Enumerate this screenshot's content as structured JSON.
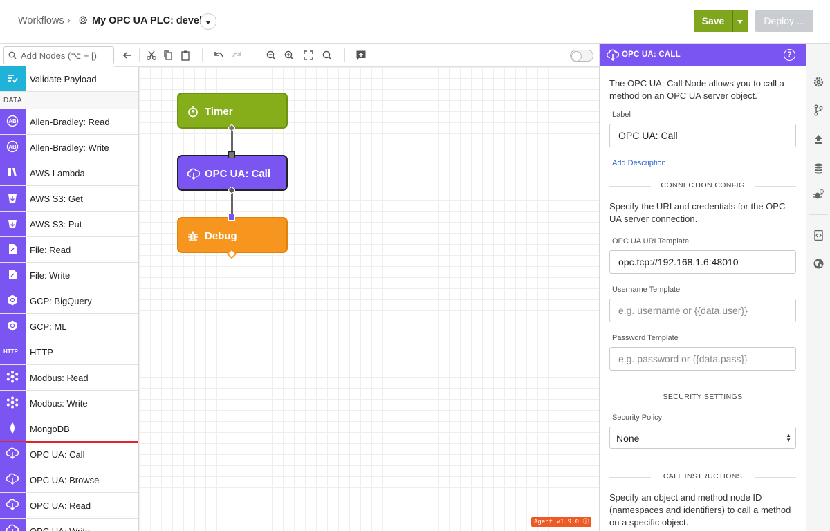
{
  "header": {
    "breadcrumb": "Workflows",
    "separator": "›",
    "workflow_title": "My OPC UA PLC: develop",
    "save_label": "Save",
    "deploy_label": "Deploy ..."
  },
  "palette": {
    "search_placeholder": "Add Nodes (⌥ + [)",
    "top_item": {
      "label": "Validate Payload",
      "icon": "validate-icon"
    },
    "section_label": "DATA",
    "items": [
      {
        "label": "Allen-Bradley: Read",
        "icon": "ab-icon"
      },
      {
        "label": "Allen-Bradley: Write",
        "icon": "ab-icon"
      },
      {
        "label": "AWS Lambda",
        "icon": "lambda-icon"
      },
      {
        "label": "AWS S3: Get",
        "icon": "bucket-icon"
      },
      {
        "label": "AWS S3: Put",
        "icon": "bucket-icon"
      },
      {
        "label": "File: Read",
        "icon": "file-icon"
      },
      {
        "label": "File: Write",
        "icon": "file-icon"
      },
      {
        "label": "GCP: BigQuery",
        "icon": "gcp-icon"
      },
      {
        "label": "GCP: ML",
        "icon": "gcp-icon"
      },
      {
        "label": "HTTP",
        "icon": "http-icon"
      },
      {
        "label": "Modbus: Read",
        "icon": "modbus-icon"
      },
      {
        "label": "Modbus: Write",
        "icon": "modbus-icon"
      },
      {
        "label": "MongoDB",
        "icon": "mongodb-icon"
      },
      {
        "label": "OPC UA: Call",
        "icon": "cloud-icon"
      },
      {
        "label": "OPC UA: Browse",
        "icon": "cloud-icon"
      },
      {
        "label": "OPC UA: Read",
        "icon": "cloud-icon"
      },
      {
        "label": "OPC UA: Write",
        "icon": "cloud-icon"
      }
    ],
    "http_icon_text": "HTTP"
  },
  "canvas": {
    "nodes": [
      {
        "label": "Timer",
        "icon": "stopwatch-icon"
      },
      {
        "label": "OPC UA: Call",
        "icon": "cloud-icon"
      },
      {
        "label": "Debug",
        "icon": "bug-icon"
      }
    ],
    "agent_version": "Agent v1.9.0"
  },
  "panel": {
    "title": "OPC UA: CALL",
    "help": "?",
    "intro": "The OPC UA: Call Node allows you to call a method on an OPC UA server object.",
    "label_label": "Label",
    "label_value": "OPC UA: Call",
    "add_description": "Add Description",
    "connection_section": "CONNECTION CONFIG",
    "connection_text": "Specify the URI and credentials for the OPC UA server connection.",
    "uri_label": "OPC UA URI Template",
    "uri_value": "opc.tcp://192.168.1.6:48010",
    "username_label": "Username Template",
    "username_placeholder": "e.g. username or {{data.user}}",
    "password_label": "Password Template",
    "password_placeholder": "e.g. password or {{data.pass}}",
    "security_section": "SECURITY SETTINGS",
    "security_policy_label": "Security Policy",
    "security_policy_value": "None",
    "call_section": "CALL INSTRUCTIONS",
    "call_text": "Specify an object and method node ID (namespaces and identifiers) to call a method on a specific object."
  },
  "colors": {
    "accent_purple": "#7a55f2",
    "save_green": "#7fa61c",
    "timer_green": "#86ad1a",
    "debug_orange": "#f7961f",
    "selection_red": "#e0242a"
  }
}
